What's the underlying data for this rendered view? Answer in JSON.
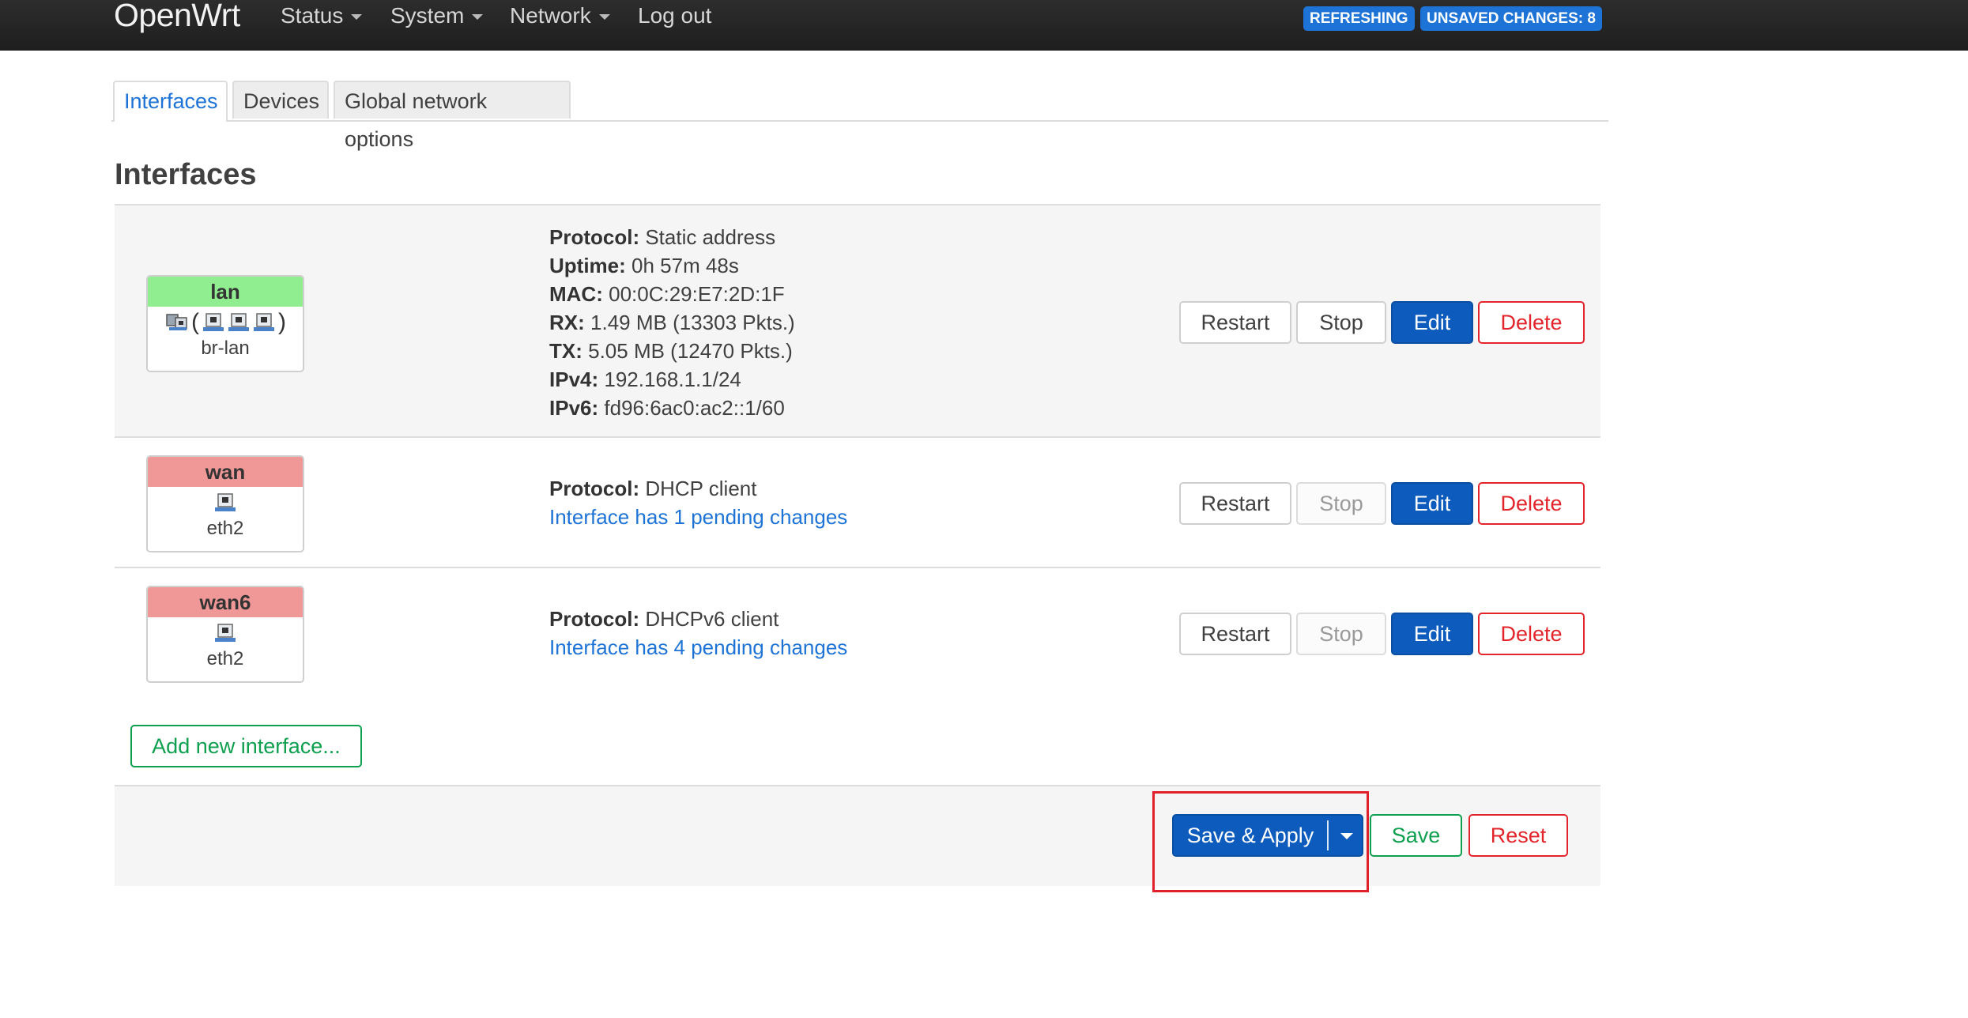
{
  "navbar": {
    "brand": "OpenWrt",
    "menu": [
      {
        "label": "Status",
        "has_dropdown": true
      },
      {
        "label": "System",
        "has_dropdown": true
      },
      {
        "label": "Network",
        "has_dropdown": true
      },
      {
        "label": "Log out",
        "has_dropdown": false
      }
    ],
    "badges": [
      "REFRESHING",
      "UNSAVED CHANGES: 8"
    ]
  },
  "tabs": [
    {
      "label": "Interfaces",
      "active": true
    },
    {
      "label": "Devices",
      "active": false
    },
    {
      "label": "Global network options",
      "active": false
    }
  ],
  "section_title": "Interfaces",
  "interfaces": [
    {
      "name": "lan",
      "header_color": "#90ee90",
      "device": "br-lan",
      "icons": [
        "bridge-icon",
        "network-port-icon",
        "network-port-icon",
        "network-port-icon"
      ],
      "info": [
        {
          "label": "Protocol:",
          "value": "Static address"
        },
        {
          "label": "Uptime:",
          "value": "0h 57m 48s"
        },
        {
          "label": "MAC:",
          "value": "00:0C:29:E7:2D:1F"
        },
        {
          "label": "RX:",
          "value": "1.49 MB (13303 Pkts.)"
        },
        {
          "label": "TX:",
          "value": "5.05 MB (12470 Pkts.)"
        },
        {
          "label": "IPv4:",
          "value": "192.168.1.1/24"
        },
        {
          "label": "IPv6:",
          "value": "fd96:6ac0:ac2::1/60"
        }
      ],
      "pending": "",
      "buttons": {
        "restart": "Restart",
        "stop": "Stop",
        "edit": "Edit",
        "delete": "Delete"
      },
      "stop_disabled": false
    },
    {
      "name": "wan",
      "header_color": "#f09898",
      "device": "eth2",
      "icons": [
        "network-port-icon"
      ],
      "info": [
        {
          "label": "Protocol:",
          "value": "DHCP client"
        }
      ],
      "pending": "Interface has 1 pending changes",
      "buttons": {
        "restart": "Restart",
        "stop": "Stop",
        "edit": "Edit",
        "delete": "Delete"
      },
      "stop_disabled": true
    },
    {
      "name": "wan6",
      "header_color": "#f09898",
      "device": "eth2",
      "icons": [
        "network-port-icon"
      ],
      "info": [
        {
          "label": "Protocol:",
          "value": "DHCPv6 client"
        }
      ],
      "pending": "Interface has 4 pending changes",
      "buttons": {
        "restart": "Restart",
        "stop": "Stop",
        "edit": "Edit",
        "delete": "Delete"
      },
      "stop_disabled": true
    }
  ],
  "add_interface_label": "Add new interface...",
  "footer": {
    "save_apply": "Save & Apply",
    "save": "Save",
    "reset": "Reset"
  },
  "colors": {
    "navbar_bg": "#222222",
    "accent": "#1e73d6",
    "primary_button": "#0d5cbd",
    "danger": "#e3242b",
    "success": "#0e9f4f",
    "highlight": "#e0202a"
  }
}
